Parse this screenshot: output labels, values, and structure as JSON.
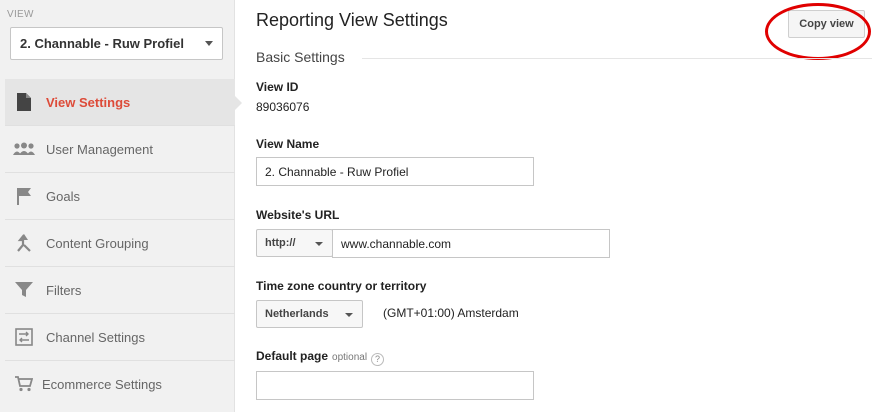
{
  "sidebar": {
    "view_label": "VIEW",
    "view_select": "2. Channable - Ruw Profiel",
    "items": [
      {
        "label": "View Settings",
        "icon": "document-icon",
        "active": true
      },
      {
        "label": "User Management",
        "icon": "users-icon",
        "active": false
      },
      {
        "label": "Goals",
        "icon": "flag-icon",
        "active": false
      },
      {
        "label": "Content Grouping",
        "icon": "content-grouping-icon",
        "active": false
      },
      {
        "label": "Filters",
        "icon": "filter-icon",
        "active": false
      },
      {
        "label": "Channel Settings",
        "icon": "channel-settings-icon",
        "active": false
      },
      {
        "label": "Ecommerce Settings",
        "icon": "cart-icon",
        "active": false
      }
    ]
  },
  "main": {
    "title": "Reporting View Settings",
    "copy_button": "Copy view",
    "section_title": "Basic Settings",
    "view_id": {
      "label": "View ID",
      "value": "89036076"
    },
    "view_name": {
      "label": "View Name",
      "value": "2. Channable - Ruw Profiel"
    },
    "website_url": {
      "label": "Website's URL",
      "protocol": "http://",
      "value": "www.channable.com"
    },
    "timezone": {
      "label": "Time zone country or territory",
      "country": "Netherlands",
      "zone": "(GMT+01:00) Amsterdam"
    },
    "default_page": {
      "label": "Default page",
      "optional": "optional",
      "help": "?",
      "value": ""
    }
  },
  "colors": {
    "active_text": "#dd4b39",
    "highlight_circle": "#e00000",
    "sidebar_bg": "#f1f1f1"
  }
}
